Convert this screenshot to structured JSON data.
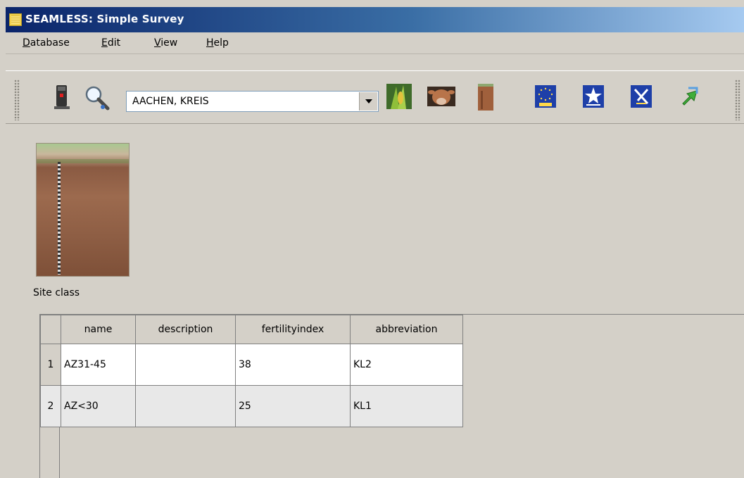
{
  "window": {
    "title": "SEAMLESS: Simple Survey"
  },
  "menu": [
    {
      "label": "Database",
      "mnemonic": "D",
      "rest": "atabase"
    },
    {
      "label": "Edit",
      "mnemonic": "E",
      "rest": "dit"
    },
    {
      "label": "View",
      "mnemonic": "V",
      "rest": "iew"
    },
    {
      "label": "Help",
      "mnemonic": "H",
      "rest": "elp"
    }
  ],
  "toolbar": {
    "region_value": "AACHEN, KREIS",
    "icons": [
      "database-icon",
      "search-icon",
      "crop-icon",
      "livestock-icon",
      "soil-profile-icon",
      "eu-cap-icon",
      "eu-star-icon",
      "eu-policy-icon",
      "green-arrow-icon"
    ]
  },
  "site": {
    "image_name": "soil-profile-image",
    "caption": "Site class"
  },
  "table": {
    "columns": [
      "name",
      "description",
      "fertilityindex",
      "abbreviation"
    ],
    "rows": [
      {
        "num": "1",
        "name": "AZ31-45",
        "description": "",
        "fertilityindex": "38",
        "abbreviation": "KL2"
      },
      {
        "num": "2",
        "name": "AZ<30",
        "description": "",
        "fertilityindex": "25",
        "abbreviation": "KL1"
      }
    ]
  },
  "colors": {
    "titlebar_start": "#0a246a",
    "titlebar_end": "#a6caf0",
    "chrome": "#d4d0c8"
  }
}
